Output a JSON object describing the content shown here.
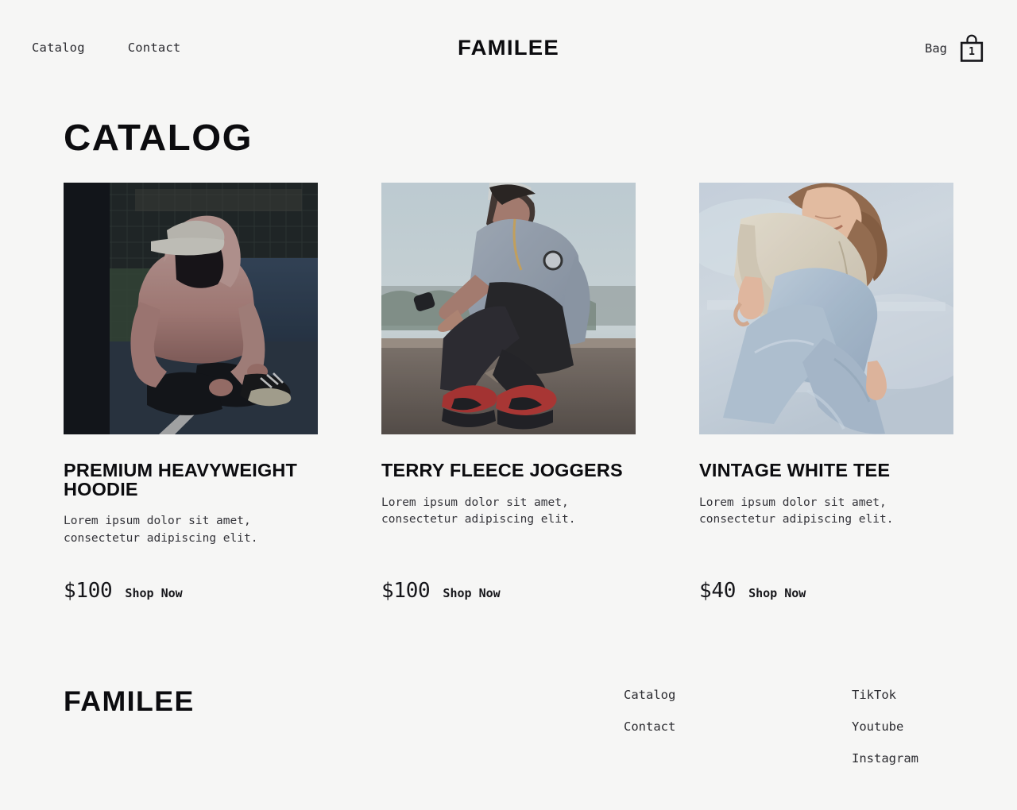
{
  "theme": {
    "background": "#f6f6f5",
    "text": "#16161a",
    "muted": "#34343a"
  },
  "header": {
    "nav": [
      {
        "label": "Catalog"
      },
      {
        "label": "Contact"
      }
    ],
    "brand": "FAMILEE",
    "bag": {
      "label": "Bag",
      "icon": "shopping-bag-icon",
      "count": "1"
    }
  },
  "main": {
    "title": "CATALOG",
    "products": [
      {
        "title": "PREMIUM HEAVYWEIGHT HOODIE",
        "description": "Lorem ipsum dolor sit amet, consectetur adipiscing elit.",
        "price": "$100",
        "cta": "Shop Now",
        "image_alt": "Person in pink hoodie and white cap sitting by a tennis net"
      },
      {
        "title": "TERRY FLEECE JOGGERS",
        "description": "Lorem ipsum dolor sit amet, consectetur adipiscing elit.",
        "price": "$100",
        "cta": "Shop Now",
        "image_alt": "Man in grey oversized tee and black joggers with red sneakers sitting on a ledge"
      },
      {
        "title": "VINTAGE WHITE TEE",
        "description": "Lorem ipsum dolor sit amet, consectetur adipiscing elit.",
        "price": "$40",
        "cta": "Shop Now",
        "image_alt": "Woman in cream top and light blue jeans against pale sky"
      }
    ]
  },
  "footer": {
    "brand": "FAMILEE",
    "nav_links": [
      {
        "label": "Catalog"
      },
      {
        "label": "Contact"
      }
    ],
    "social_links": [
      {
        "label": "TikTok"
      },
      {
        "label": "Youtube"
      },
      {
        "label": "Instagram"
      }
    ]
  }
}
